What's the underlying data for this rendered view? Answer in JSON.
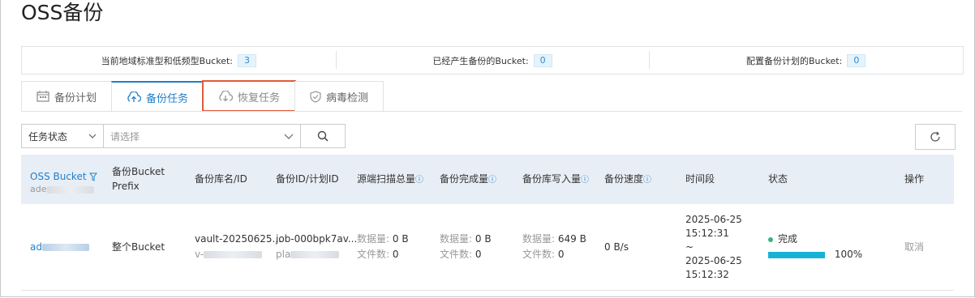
{
  "page": {
    "title": "OSS备份"
  },
  "stats": [
    {
      "label": "当前地域标准型和低频型Bucket:",
      "value": "3"
    },
    {
      "label": "已经产生备份的Bucket:",
      "value": "0"
    },
    {
      "label": "配置备份计划的Bucket:",
      "value": "0"
    }
  ],
  "tabs": [
    {
      "label": "备份计划",
      "icon": "calendar-icon"
    },
    {
      "label": "备份任务",
      "icon": "cloud-upload-icon"
    },
    {
      "label": "恢复任务",
      "icon": "cloud-download-icon"
    },
    {
      "label": "病毒检测",
      "icon": "shield-check-icon"
    }
  ],
  "filter": {
    "field": "任务状态",
    "placeholder": "请选择"
  },
  "table": {
    "headers": {
      "bucket": "OSS Bucket",
      "bucket_sub": "ade",
      "prefix": "备份Bucket Prefix",
      "vault": "备份库名/ID",
      "job": "备份ID/计划ID",
      "scan": "源端扫描总量",
      "done": "备份完成量",
      "write": "备份库写入量",
      "speed": "备份速度",
      "period": "时间段",
      "status": "状态",
      "action": "操作"
    },
    "row": {
      "bucket": "ad",
      "prefix": "整个Bucket",
      "vault_name": "vault-20250625...",
      "vault_id": "v-",
      "job_id": "job-000bpk7av...",
      "plan_id": "pla",
      "scan_data_label": "数据量:",
      "scan_data": "0 B",
      "scan_files_label": "文件数:",
      "scan_files": "0",
      "done_data_label": "数据量:",
      "done_data": "0 B",
      "done_files_label": "文件数:",
      "done_files": "0",
      "write_data_label": "数据量:",
      "write_data": "649 B",
      "write_files_label": "文件数:",
      "write_files": "0",
      "speed": "0 B/s",
      "start_date": "2025-06-25",
      "start_time": "15:12:31",
      "sep": "~",
      "end_date": "2025-06-25",
      "end_time": "15:12:32",
      "status": "完成",
      "progress": "100%",
      "progress_value": 1.0,
      "action": "取消"
    }
  }
}
